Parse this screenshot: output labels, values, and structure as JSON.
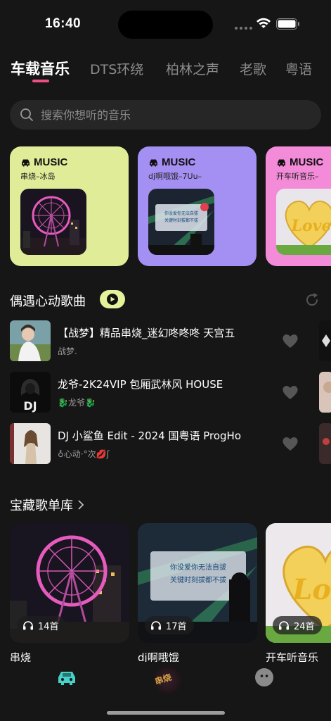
{
  "status_bar": {
    "time": "16:40"
  },
  "tabs": [
    {
      "label": "车载音乐"
    },
    {
      "label": "DTS环绕"
    },
    {
      "label": "柏林之声"
    },
    {
      "label": "老歌"
    },
    {
      "label": "粤语"
    }
  ],
  "search": {
    "placeholder": "搜索你想听的音乐"
  },
  "cards": [
    {
      "brand": "MUSIC",
      "subtitle": "串烧–冰岛",
      "bg": "#e0ec98"
    },
    {
      "brand": "MUSIC",
      "subtitle": "dj啊哦饿–7Uu–",
      "bg": "#a48ff2"
    },
    {
      "brand": "MUSIC",
      "subtitle": "开车听音乐–",
      "bg": "#f38bd9"
    }
  ],
  "section_heartbeat": {
    "title": "偶遇心动歌曲"
  },
  "songs": [
    {
      "name": "【战梦】精品串烧_迷幻咚咚咚 天宫五",
      "artist": "战梦."
    },
    {
      "name": "龙爷-2K24VIP 包厢武林风 HOUSE",
      "artist": "🐉龙爷🐉"
    },
    {
      "name": "DJ 小鲨鱼 Edit - 2024 国粤语 ProgHo",
      "artist": "♁心动·°次💋ʃ"
    }
  ],
  "section_playlists": {
    "title": "宝藏歌单库"
  },
  "playlists": [
    {
      "name": "串烧",
      "count": "14首"
    },
    {
      "name": "dj啊哦饿",
      "count": "17首"
    },
    {
      "name": "开车听音乐",
      "count": "24首"
    }
  ],
  "colors": {
    "accent": "#ee4d86",
    "tabbar_car": "#45d0c8"
  },
  "thumb_texts": {
    "dj_text": "DJ",
    "slogan_1": "你没爱你无法自拔",
    "slogan_2": "关键时刻拔都不拔",
    "love": "Love"
  }
}
